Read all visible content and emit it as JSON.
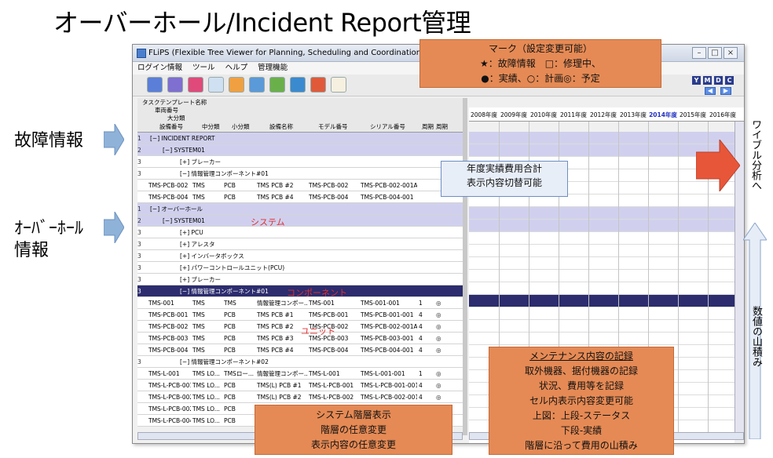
{
  "slide": {
    "title": "オーバーホール/Incident Report管理",
    "left_labels": {
      "failure": "故障情報",
      "overhaul_line1": "ｵｰﾊﾞｰﾎｰﾙ",
      "overhaul_line2": "情報"
    },
    "right_labels": {
      "weibull": "ワイブル分析へ",
      "stacking": "数値の山積み"
    }
  },
  "window": {
    "title": "FLiPS (Flexible Tree Viewer for Planning, Scheduling and Coordination (TM))",
    "menu": [
      "ログイン情報",
      "ツール",
      "ヘルプ",
      "管理機能"
    ],
    "right_buttons": [
      "Y",
      "M",
      "D",
      "C"
    ],
    "win_buttons": [
      "–",
      "□",
      "×"
    ]
  },
  "grid": {
    "header_rows": [
      "タスクテンプレート名称",
      "車両番号",
      "大分類"
    ],
    "columns": [
      "設備番号",
      "中分類",
      "小分類",
      "設備名称",
      "モデル番号",
      "シリアル番号",
      "周期",
      "周期"
    ],
    "rows": [
      {
        "num": "1",
        "style": "level",
        "indent": 4,
        "text": "[−]  INCIDENT REPORT"
      },
      {
        "num": "2",
        "style": "level",
        "indent": 20,
        "text": "[−]  SYSTEM01"
      },
      {
        "num": "3",
        "style": "white",
        "indent": 42,
        "text": "[+]  ブレーカー"
      },
      {
        "num": "3",
        "style": "white",
        "indent": 42,
        "text": "[−]  情報管理コンポーネント#01"
      },
      {
        "num": "",
        "style": "white",
        "cells": [
          "TMS-PCB-002",
          "TMS",
          "PCB",
          "TMS PCB #2",
          "TMS-PCB-002",
          "TMS-PCB-002-001A",
          "",
          ""
        ]
      },
      {
        "num": "",
        "style": "white",
        "cells": [
          "TMS-PCB-004",
          "TMS",
          "PCB",
          "TMS PCB #4",
          "TMS-PCB-004",
          "TMS-PCB-004-001",
          "",
          ""
        ]
      },
      {
        "num": "1",
        "style": "level",
        "indent": 4,
        "text": "[−]  オーバーホール"
      },
      {
        "num": "2",
        "style": "level",
        "indent": 20,
        "text": "[−]  SYSTEM01"
      },
      {
        "num": "3",
        "style": "white",
        "indent": 42,
        "text": "[+]  PCU"
      },
      {
        "num": "3",
        "style": "white",
        "indent": 42,
        "text": "[+]  アレスタ"
      },
      {
        "num": "3",
        "style": "white",
        "indent": 42,
        "text": "[+]  インバータボックス"
      },
      {
        "num": "3",
        "style": "white",
        "indent": 42,
        "text": "[+]  パワーコントロールユニット(PCU)"
      },
      {
        "num": "3",
        "style": "white",
        "indent": 42,
        "text": "[+]  ブレーカー"
      },
      {
        "num": "3",
        "style": "sel",
        "indent": 42,
        "text": "[−]  情報管理コンポーネント#01"
      },
      {
        "num": "",
        "style": "white",
        "cells": [
          "TMS-001",
          "TMS",
          "TMS",
          "情報管理コンポー...",
          "TMS-001",
          "TMS-001-001",
          "1",
          "◎"
        ]
      },
      {
        "num": "",
        "style": "white",
        "cells": [
          "TMS-PCB-001",
          "TMS",
          "PCB",
          "TMS PCB #1",
          "TMS-PCB-001",
          "TMS-PCB-001-001",
          "4",
          "◎"
        ]
      },
      {
        "num": "",
        "style": "white",
        "cells": [
          "TMS-PCB-002",
          "TMS",
          "PCB",
          "TMS PCB #2",
          "TMS-PCB-002",
          "TMS-PCB-002-001A",
          "4",
          "◎"
        ]
      },
      {
        "num": "",
        "style": "white",
        "cells": [
          "TMS-PCB-003",
          "TMS",
          "PCB",
          "TMS PCB #3",
          "TMS-PCB-003",
          "TMS-PCB-003-001",
          "4",
          "◎"
        ]
      },
      {
        "num": "",
        "style": "white",
        "cells": [
          "TMS-PCB-004",
          "TMS",
          "PCB",
          "TMS PCB #4",
          "TMS-PCB-004",
          "TMS-PCB-004-001",
          "4",
          "◎"
        ]
      },
      {
        "num": "3",
        "style": "white",
        "indent": 42,
        "text": "[−]  情報管理コンポーネント#02"
      },
      {
        "num": "",
        "style": "white",
        "cells": [
          "TMS-L-001",
          "TMS LO...",
          "TMSロー...",
          "情報管理コンポー...",
          "TMS-L-001",
          "TMS-L-001-001",
          "1",
          "◎"
        ]
      },
      {
        "num": "",
        "style": "white",
        "cells": [
          "TMS-L-PCB-001",
          "TMS LO...",
          "PCB",
          "TMS(L) PCB #1",
          "TMS-L-PCB-001",
          "TMS-L-PCB-001-001",
          "4",
          "◎"
        ]
      },
      {
        "num": "",
        "style": "white",
        "cells": [
          "TMS-L-PCB-002",
          "TMS LO...",
          "PCB",
          "TMS(L) PCB #2",
          "TMS-L-PCB-002",
          "TMS-L-PCB-002-001",
          "4",
          "◎"
        ]
      },
      {
        "num": "",
        "style": "white",
        "cells": [
          "TMS-L-PCB-002",
          "TMS LO...",
          "PCB",
          "",
          "",
          "",
          "",
          ""
        ]
      },
      {
        "num": "",
        "style": "white",
        "cells": [
          "TMS-L-PCB-004",
          "TMS LO...",
          "PCB",
          "",
          "",
          "",
          "",
          ""
        ]
      }
    ]
  },
  "years": [
    "2008年度",
    "2009年度",
    "2010年度",
    "2011年度",
    "2012年度",
    "2013年度",
    "2014年度",
    "2015年度",
    "2016年度"
  ],
  "annotations": {
    "mark_title": "マーク（設定変更可能）",
    "mark_line1": "★：故障情報　□：修理中、",
    "mark_line2": "●：実績、○：計画◎：予定",
    "annual_cost_line1": "年度実績費用合計",
    "annual_cost_line2": "表示内容切替可能",
    "system_label": "システム",
    "component_label": "コンポーネント",
    "unit_label": "ユニット",
    "hierarchy_line1": "システム階層表示",
    "hierarchy_line2": "階層の任意変更",
    "hierarchy_line3": "表示内容の任意変更",
    "maint_line1": "メンテナンス内容の記録",
    "maint_line2": "取外機器、据付機器の記録",
    "maint_line3": "状況、費用等を記録",
    "maint_line4": "セル内表示内容変更可能",
    "maint_line5": "上図：上段-ステータス",
    "maint_line6": "下段-実績",
    "maint_line7": "階層に沿って費用の山積み"
  },
  "colors": {
    "level_row": "#d0d0ee",
    "selected_row": "#2c2c6e",
    "callout": "#e58a55",
    "arrow": "#e8563a"
  }
}
